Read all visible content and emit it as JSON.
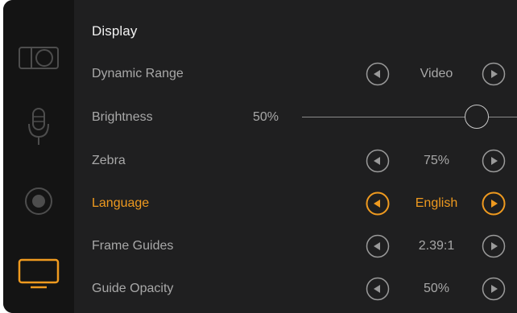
{
  "sidebar": {
    "items": [
      {
        "icon": "camera-icon",
        "active": false
      },
      {
        "icon": "microphone-icon",
        "active": false
      },
      {
        "icon": "record-icon",
        "active": false
      },
      {
        "icon": "monitor-icon",
        "active": true
      }
    ]
  },
  "colors": {
    "accent": "#ef9a1f",
    "background": "#1f1f20",
    "sidebar": "#141414",
    "text": "#a8a8a8",
    "title": "#f2f2f2"
  },
  "display": {
    "title": "Display",
    "rows": [
      {
        "label": "Dynamic Range",
        "value": "Video",
        "active": false
      },
      {
        "label": "Brightness",
        "value": "50%",
        "slider": 0.5
      },
      {
        "label": "Zebra",
        "value": "75%",
        "active": false
      },
      {
        "label": "Language",
        "value": "English",
        "active": true
      },
      {
        "label": "Frame Guides",
        "value": "2.39:1",
        "active": false
      },
      {
        "label": "Guide Opacity",
        "value": "50%",
        "active": false
      }
    ]
  }
}
